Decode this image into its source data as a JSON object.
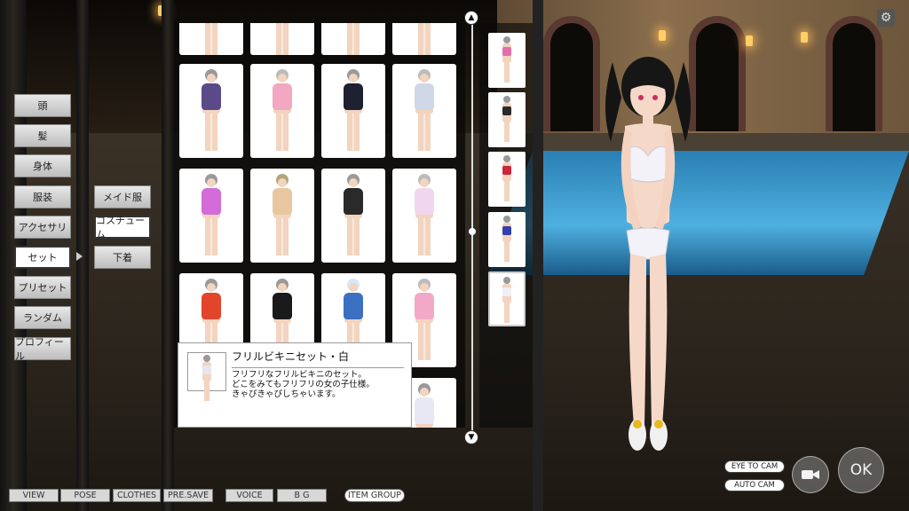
{
  "categories": [
    "頭",
    "髪",
    "身体",
    "服装",
    "アクセサリ",
    "セット",
    "プリセット",
    "ランダム",
    "プロフィール"
  ],
  "active_category": "セット",
  "subcategories": [
    "メイド服",
    "コスチューム",
    "下着"
  ],
  "active_subcategory": "コスチューム",
  "grid_items": [
    {
      "outfit": "#5a4a8a",
      "hair": "#9a9a9a"
    },
    {
      "outfit": "#f3a7c0",
      "hair": "#bcbcbc"
    },
    {
      "outfit": "#1e2230",
      "hair": "#9a9a9a"
    },
    {
      "outfit": "#cfd8e6",
      "hair": "#bcbcbc"
    },
    {
      "outfit": "#d36bd8",
      "hair": "#9a9a9a"
    },
    {
      "outfit": "#e8c7a0",
      "hair": "#b3a67c"
    },
    {
      "outfit": "#2a2a2a",
      "hair": "#9a9a9a"
    },
    {
      "outfit": "#f1d7ee",
      "hair": "#bcbcbc"
    },
    {
      "outfit": "#e2452a",
      "hair": "#9a9a9a"
    },
    {
      "outfit": "#1a1a1a",
      "hair": "#9a9a9a"
    },
    {
      "outfit": "#3b6fc2",
      "hair": "#d8e6f5"
    },
    {
      "outfit": "#f2a9c8",
      "hair": "#bcbcbc"
    },
    {
      "outfit": "#e8e8f4",
      "hair": "#9a9a9a"
    }
  ],
  "history_items": [
    {
      "outfit": "#e36fa8"
    },
    {
      "outfit": "#2a2a2a"
    },
    {
      "outfit": "#c8283a"
    },
    {
      "outfit": "#3240a8"
    },
    {
      "outfit": "#f0f0f6"
    }
  ],
  "tooltip": {
    "title": "フリルビキニセット・白",
    "lines": [
      "フリフリなフリルビキニのセット。",
      "どこをみてもフリフリの女の子仕様。",
      "きゃぴきゃぴしちゃいます。"
    ]
  },
  "bottom_bar": [
    "VIEW",
    "POSE",
    "CLOTHES",
    "PRE.SAVE",
    "VOICE",
    "B G",
    "ITEM GROUP"
  ],
  "camera": {
    "eye_to_cam": "EYE TO CAM",
    "auto_cam": "AUTO CAM"
  },
  "ok_label": "OK",
  "icons": {
    "settings": "gear-icon",
    "video": "video-camera-icon",
    "scroll_up": "triangle-up-icon",
    "scroll_down": "triangle-down-icon"
  }
}
